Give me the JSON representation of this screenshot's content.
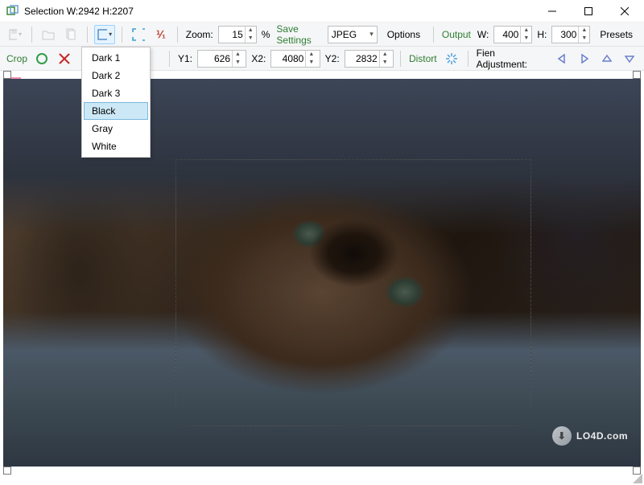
{
  "titlebar": {
    "title": "Selection  W:2942 H:2207"
  },
  "toolbar1": {
    "zoom_label": "Zoom:",
    "zoom_value": "15",
    "zoom_pct": "%",
    "save_settings": "Save Settings",
    "format_value": "JPEG",
    "options": "Options",
    "output_label": "Output",
    "w_label": "W:",
    "w_value": "400",
    "h_label": "H:",
    "h_value": "300",
    "presets": "Presets",
    "fraction": "⅟₁"
  },
  "toolbar2": {
    "crop_label": "Crop",
    "y1_label": "Y1:",
    "y1_value": "626",
    "x2_label": "X2:",
    "x2_value": "4080",
    "y2_label": "Y2:",
    "y2_value": "2832",
    "distort_label": "Distort",
    "fien_label": "Fien Adjustment:"
  },
  "dropdown": {
    "items": [
      "Dark 1",
      "Dark 2",
      "Dark 3",
      "Black",
      "Gray",
      "White"
    ],
    "selected_index": 3
  },
  "watermark": {
    "text": "LO4D.com"
  }
}
